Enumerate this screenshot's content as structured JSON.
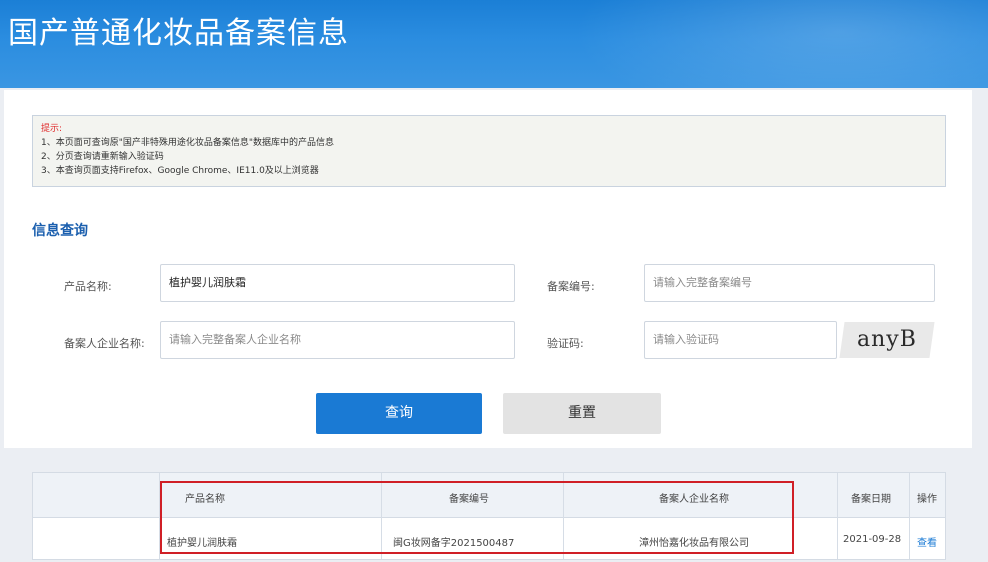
{
  "header": {
    "title": "国产普通化妆品备案信息"
  },
  "notice": {
    "title": "提示:",
    "lines": [
      "1、本页面可查询原\"国产非特殊用途化妆品备案信息\"数据库中的产品信息",
      "2、分页查询请重新输入验证码",
      "3、本查询页面支持Firefox、Google Chrome、IE11.0及以上浏览器"
    ]
  },
  "form": {
    "section_title": "信息查询",
    "product_name": {
      "label": "产品名称:",
      "value": "植护婴儿润肤霜"
    },
    "record_no": {
      "label": "备案编号:",
      "placeholder": "请输入完整备案编号"
    },
    "company": {
      "label": "备案人企业名称:",
      "placeholder": "请输入完整备案人企业名称"
    },
    "captcha": {
      "label": "验证码:",
      "placeholder": "请输入验证码",
      "image_text": "anyB"
    },
    "query_button": "查询",
    "reset_button": "重置"
  },
  "results": {
    "columns": [
      "产品名称",
      "备案编号",
      "备案人企业名称",
      "备案日期",
      "操作"
    ],
    "rows": [
      {
        "product": "植护婴儿润肤霜",
        "record_no": "闽G妆网备字2021500487",
        "company": "漳州怡嘉化妆品有限公司",
        "date": "2021-09-28",
        "action": "查看"
      }
    ]
  },
  "colors": {
    "banner": "#1b7fd6",
    "primary": "#1a7ad4",
    "highlight": "#d01f26"
  }
}
